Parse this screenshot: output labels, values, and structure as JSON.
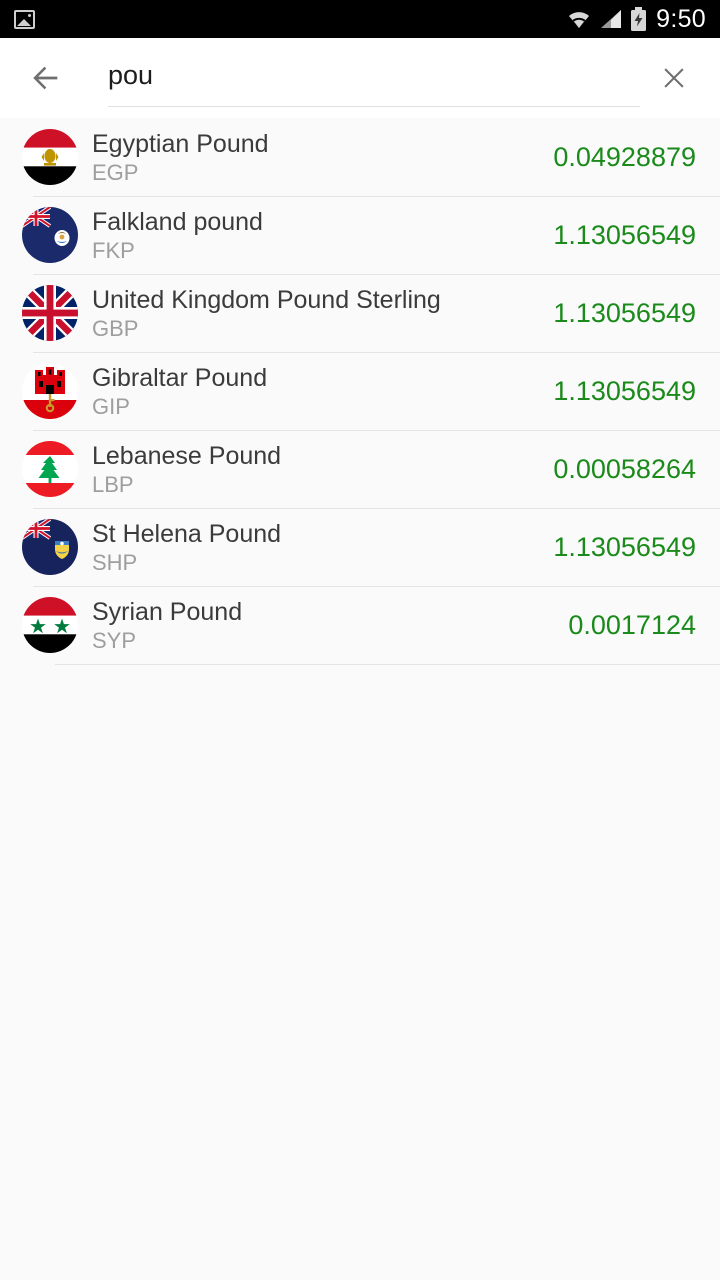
{
  "status_bar": {
    "left_icon": "image-icon",
    "wifi_icon": "wifi-icon",
    "signal_icon": "cellular-signal-icon",
    "battery_icon": "battery-charging-icon",
    "time": "9:50"
  },
  "search": {
    "back_icon": "back-arrow-icon",
    "clear_icon": "close-icon",
    "value": "pou",
    "placeholder": "Search"
  },
  "colors": {
    "rate_green": "#1a8a1a",
    "name_text": "#3b3b3b",
    "code_text": "#9e9e9e",
    "background": "#fafafa",
    "status_bar": "#000000"
  },
  "currencies": [
    {
      "name": "Egyptian Pound",
      "code": "EGP",
      "rate": "0.04928879",
      "flag": "eg"
    },
    {
      "name": "Falkland pound",
      "code": "FKP",
      "rate": "1.13056549",
      "flag": "fk"
    },
    {
      "name": "United Kingdom Pound Sterling",
      "code": "GBP",
      "rate": "1.13056549",
      "flag": "gb"
    },
    {
      "name": "Gibraltar Pound",
      "code": "GIP",
      "rate": "1.13056549",
      "flag": "gi"
    },
    {
      "name": "Lebanese Pound",
      "code": "LBP",
      "rate": "0.00058264",
      "flag": "lb"
    },
    {
      "name": "St Helena Pound",
      "code": "SHP",
      "rate": "1.13056549",
      "flag": "sh"
    },
    {
      "name": "Syrian Pound",
      "code": "SYP",
      "rate": "0.0017124",
      "flag": "sy"
    }
  ]
}
